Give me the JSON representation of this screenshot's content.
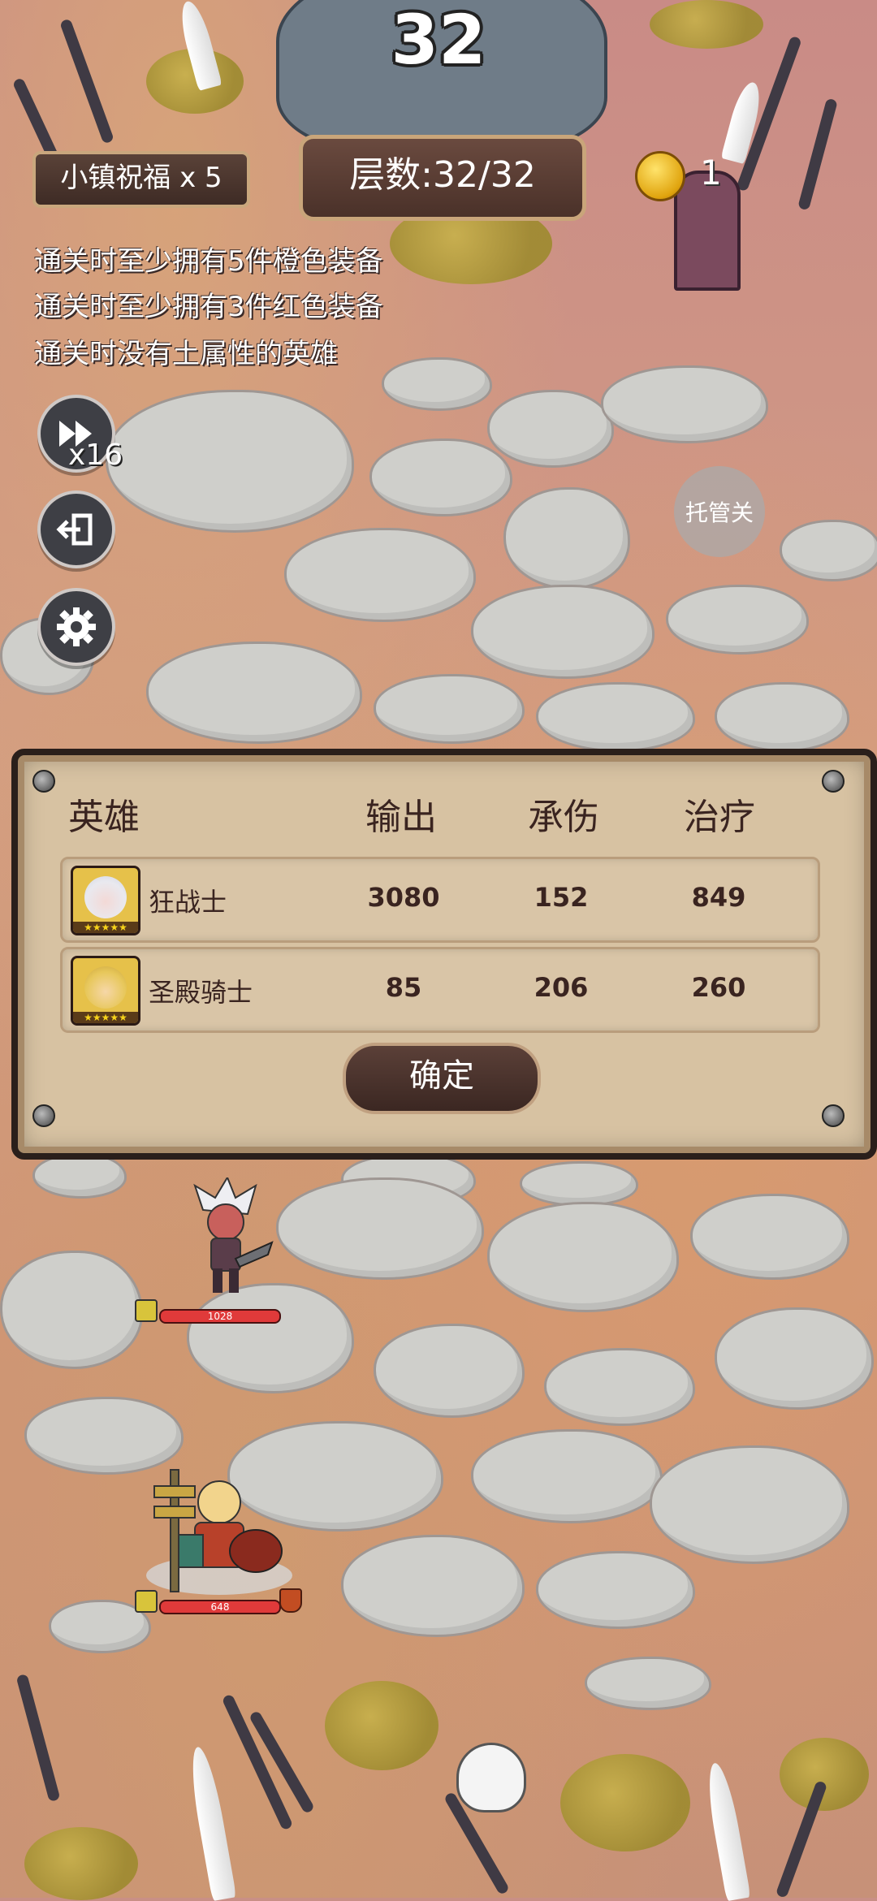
{
  "hud": {
    "floor_number": "32",
    "blessing_label": "小镇祝福 x 5",
    "floor_progress": "层数:32/32",
    "coin_count": "1"
  },
  "conditions": [
    "通关时至少拥有5件橙色装备",
    "通关时至少拥有3件红色装备",
    "通关时没有土属性的英雄"
  ],
  "controls": {
    "speed_label": "x16",
    "auto_label": "托管关",
    "icons": [
      "fast-forward-icon",
      "exit-icon",
      "settings-icon"
    ]
  },
  "result_panel": {
    "headers": {
      "hero": "英雄",
      "damage": "输出",
      "tank": "承伤",
      "heal": "治疗"
    },
    "rows": [
      {
        "name": "狂战士",
        "damage": "3080",
        "tank": "152",
        "heal": "849"
      },
      {
        "name": "圣殿骑士",
        "damage": "85",
        "tank": "206",
        "heal": "260"
      }
    ],
    "confirm_label": "确定"
  },
  "units": [
    {
      "name": "berserker",
      "hp": "1028"
    },
    {
      "name": "templar",
      "hp": "648"
    }
  ],
  "colors": {
    "panel_bg": "#d7c2a2",
    "hp_bar": "#e03a3a",
    "coin": "#e0a40e"
  }
}
